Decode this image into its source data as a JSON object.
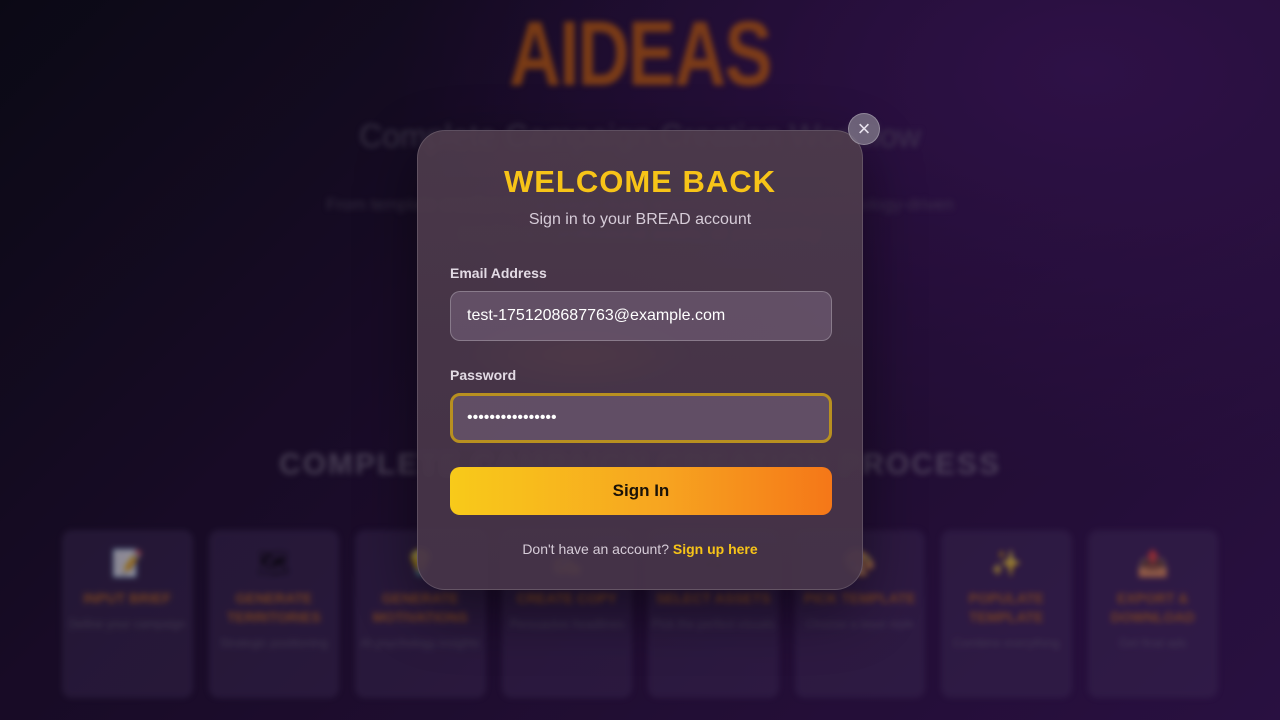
{
  "background": {
    "brand": "AIDEAS",
    "tagline": "Complete Campaign Creation Workflow",
    "blurb": "From template creation to campaign-ready advertisements using psychology-driven insights and professional assets, all powered by",
    "process_title": "COMPLETE CAMPAIGN CREATION PROCESS",
    "steps": [
      {
        "icon": "memo-icon",
        "glyph": "📝",
        "title": "INPUT BRIEF",
        "desc": "Define your campaign"
      },
      {
        "icon": "map-icon",
        "glyph": "🗺",
        "title": "GENERATE TERRITORIES",
        "desc": "Strategic positioning"
      },
      {
        "icon": "bulb-icon",
        "glyph": "💡",
        "title": "GENERATE MOTIVATIONS",
        "desc": "AI psychology insights"
      },
      {
        "icon": "pencil-icon",
        "glyph": "✍",
        "title": "CREATE COPY",
        "desc": "Persuasive headlines"
      },
      {
        "icon": "picture-icon",
        "glyph": "🖼",
        "title": "SELECT ASSETS",
        "desc": "Pick the perfect visuals"
      },
      {
        "icon": "template-icon",
        "glyph": "🎨",
        "title": "PICK TEMPLATE",
        "desc": "Choose a base style"
      },
      {
        "icon": "magic-icon",
        "glyph": "✨",
        "title": "POPULATE TEMPLATE",
        "desc": "Combine everything"
      },
      {
        "icon": "export-icon",
        "glyph": "📤",
        "title": "EXPORT & DOWNLOAD",
        "desc": "Get final ads"
      }
    ]
  },
  "modal": {
    "title": "WELCOME BACK",
    "subtitle": "Sign in to your BREAD account",
    "email_label": "Email Address",
    "email_value": "test-1751208687763@example.com",
    "password_label": "Password",
    "password_value": "••••••••••••••••",
    "sign_in_label": "Sign In",
    "footer_text": "Don't have an account?",
    "signup_link": "Sign up here",
    "close_glyph": "×"
  },
  "colors": {
    "accent": "#f7c418",
    "button_start": "#f8ca1a",
    "button_end": "#f57718"
  }
}
